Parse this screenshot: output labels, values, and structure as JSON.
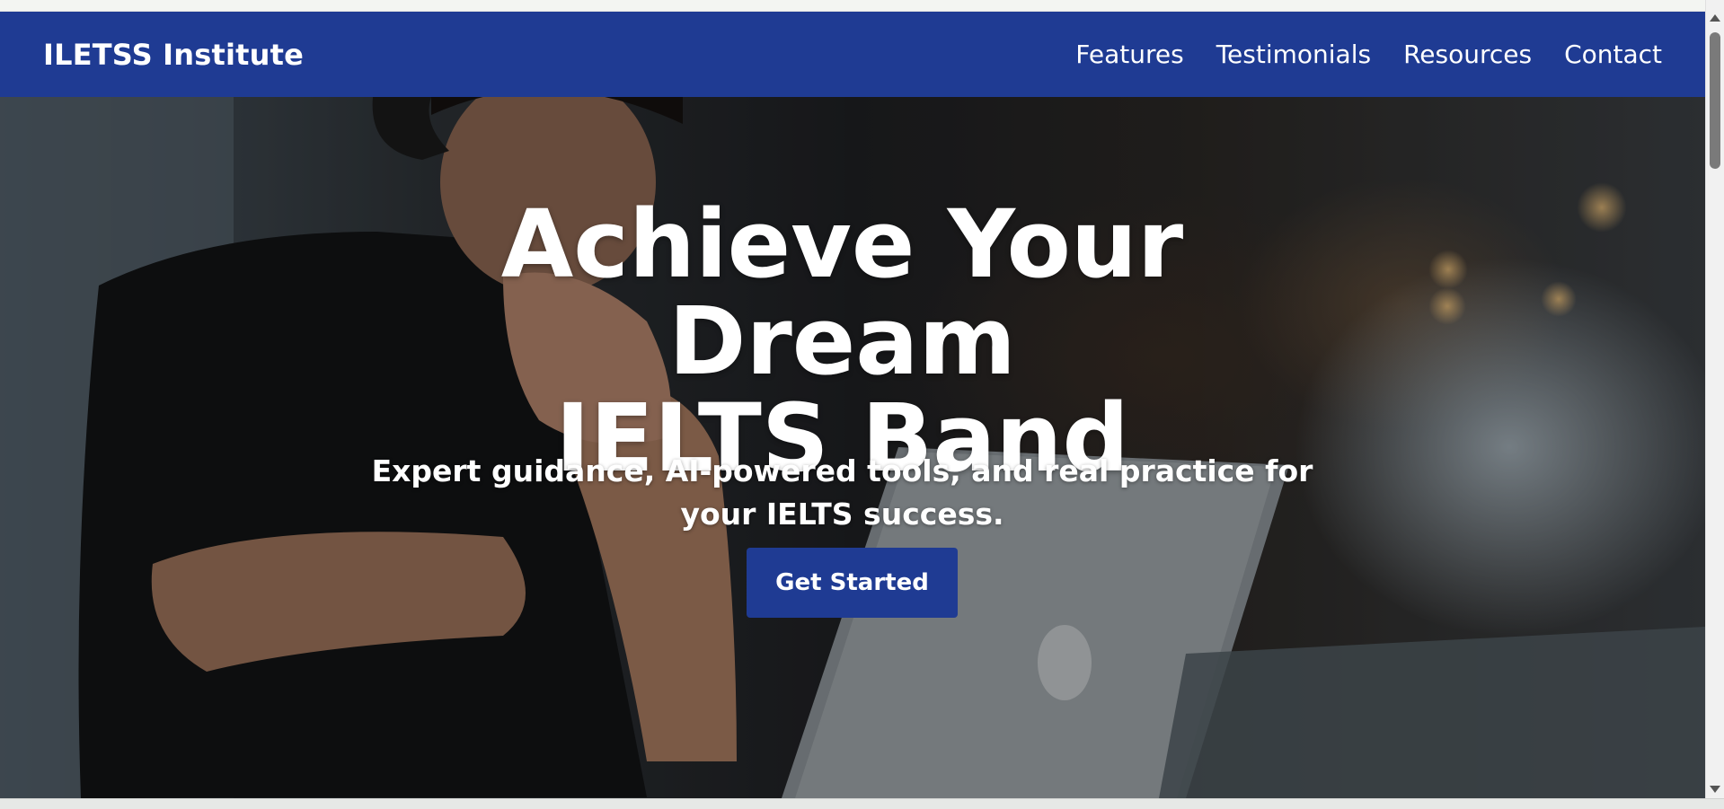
{
  "brand": {
    "name": "ILETSS Institute"
  },
  "nav": {
    "items": [
      {
        "label": "Features"
      },
      {
        "label": "Testimonials"
      },
      {
        "label": "Resources"
      },
      {
        "label": "Contact"
      }
    ]
  },
  "hero": {
    "title_line1": "Achieve Your Dream",
    "title_line2": "IELTS Band",
    "subtitle": "Expert guidance, AI-powered tools, and real practice for your IELTS success.",
    "cta_label": "Get Started"
  },
  "colors": {
    "primary": "#1f3b93",
    "text_on_primary": "#ffffff"
  },
  "icons": [
    "scroll-up-arrow-icon",
    "scroll-down-arrow-icon"
  ]
}
